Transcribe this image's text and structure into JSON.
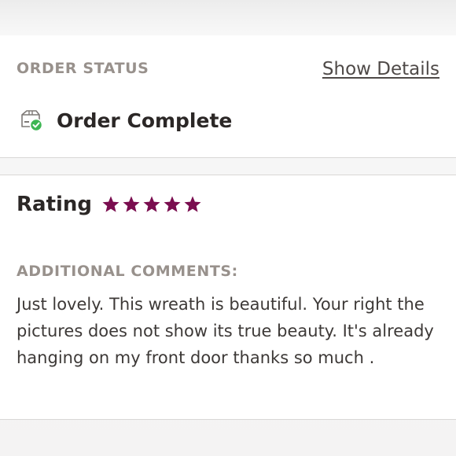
{
  "order_status": {
    "label": "ORDER STATUS",
    "details_link": "Show Details",
    "status_icon": "package-check-icon",
    "status_text": "Order Complete",
    "success_color": "#3db653"
  },
  "rating": {
    "title": "Rating",
    "stars": 5,
    "max_stars": 5,
    "star_icon": "star-icon",
    "star_color": "#7a0d4f"
  },
  "comments": {
    "label": "ADDITIONAL COMMENTS:",
    "text": "Just lovely. This wreath is beautiful. Your right the pictures does not show its true beauty. It's already hanging on my front door thanks so much ."
  }
}
